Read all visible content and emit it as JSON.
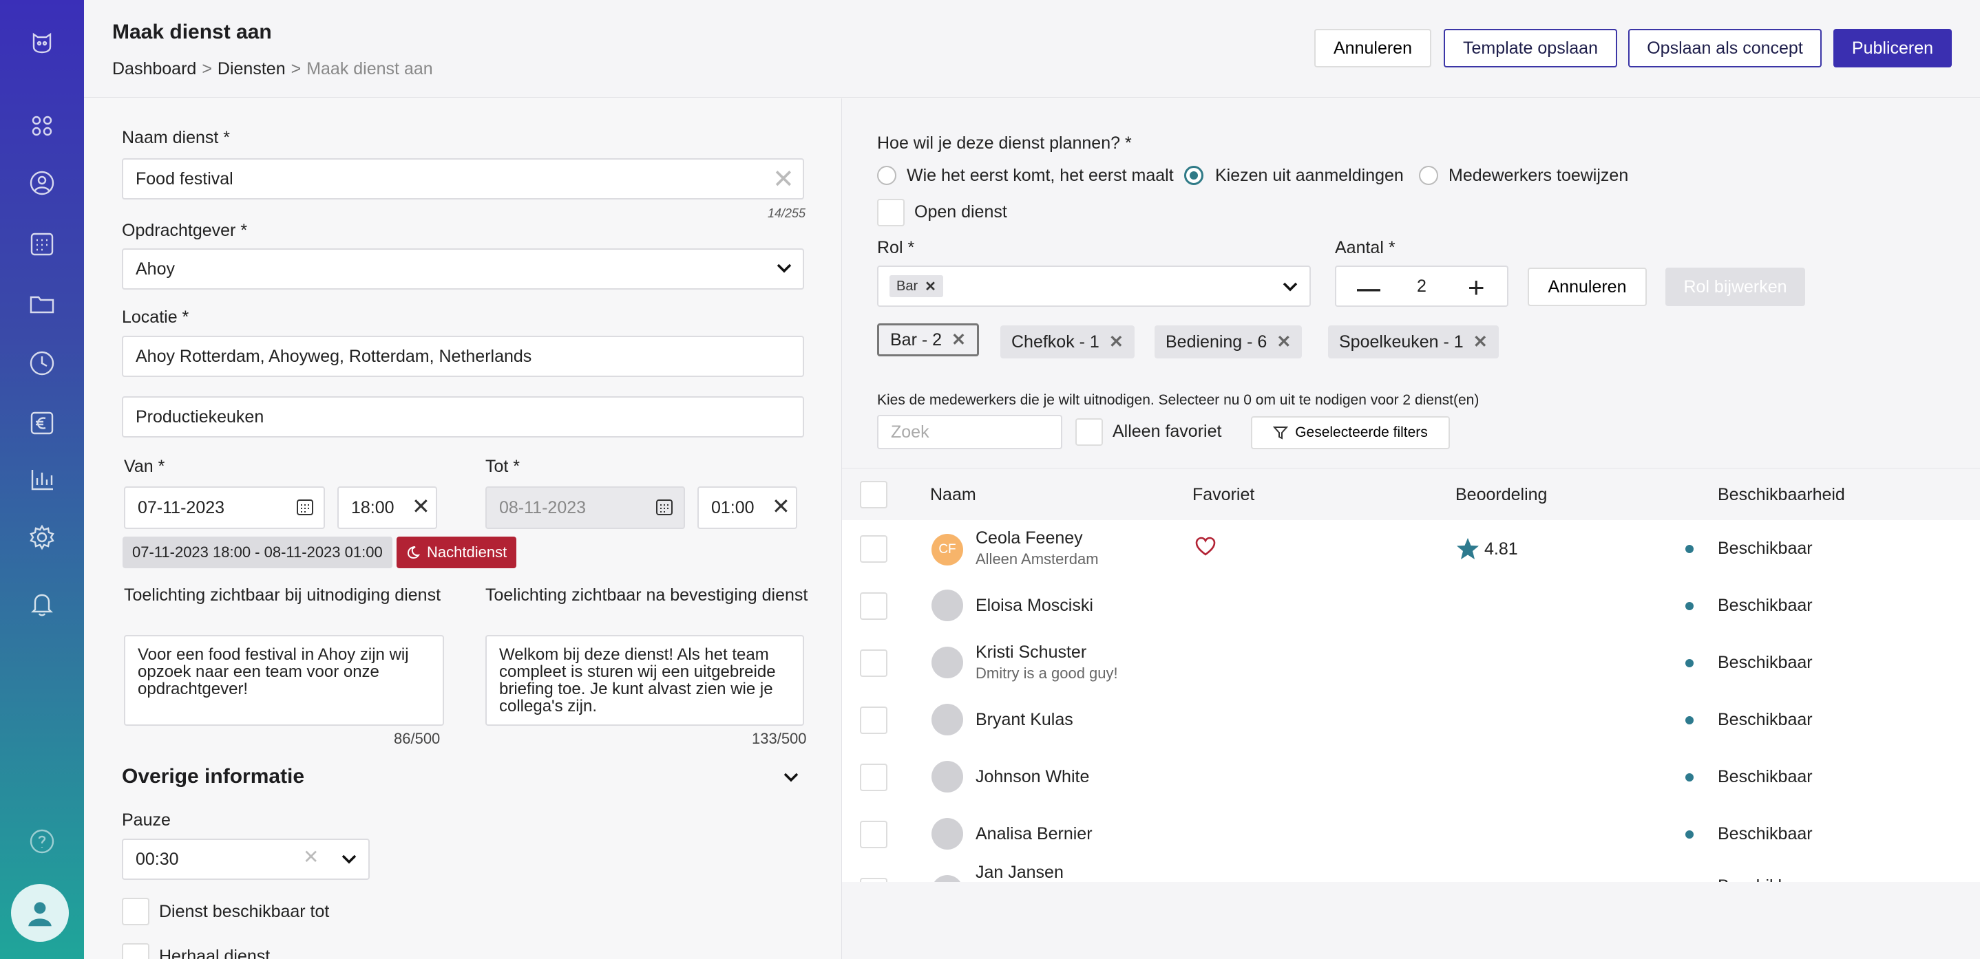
{
  "header": {
    "title": "Maak dienst aan",
    "breadcrumb": [
      "Dashboard",
      "Diensten",
      "Maak dienst aan"
    ],
    "buttons": {
      "cancel": "Annuleren",
      "save_template": "Template opslaan",
      "save_concept": "Opslaan als concept",
      "publish": "Publiceren"
    }
  },
  "sidebar": {
    "icons": [
      "logo-icon",
      "dashboard-icon",
      "user-icon",
      "calendar-icon",
      "folder-icon",
      "clock-icon",
      "euro-icon",
      "chart-icon",
      "settings-icon",
      "bell-icon",
      "help-icon",
      "profile-icon"
    ]
  },
  "form": {
    "name_label": "Naam dienst *",
    "name_value": "Food festival",
    "name_counter": "14/255",
    "client_label": "Opdrachtgever *",
    "client_value": "Ahoy",
    "location_label": "Locatie *",
    "location_value": "Ahoy Rotterdam, Ahoyweg, Rotterdam, Netherlands",
    "sublocation_value": "Productiekeuken",
    "from_label": "Van *",
    "from_date": "07-11-2023",
    "from_time": "18:00",
    "to_label": "Tot *",
    "to_date": "08-11-2023",
    "to_time": "01:00",
    "range_chip": "07-11-2023 18:00 - 08-11-2023 01:00",
    "night_chip": "Nachtdienst",
    "note_invite_label": "Toelichting zichtbaar bij uitnodiging dienst",
    "note_invite_value": "Voor een food festival in Ahoy zijn wij opzoek naar een team voor onze opdrachtgever!",
    "note_invite_counter": "86/500",
    "note_confirm_label": "Toelichting zichtbaar na bevestiging dienst",
    "note_confirm_value": "Welkom bij deze dienst! Als het team compleet is sturen wij een uitgebreide briefing toe. Je kunt alvast zien wie je collega's zijn.",
    "note_confirm_counter": "133/500",
    "other_info": "Overige informatie",
    "pause_label": "Pauze",
    "pause_value": "00:30",
    "available_until": "Dienst beschikbaar tot",
    "repeat": "Herhaal dienst"
  },
  "planning": {
    "question": "Hoe wil je deze dienst plannen? *",
    "options": [
      "Wie het eerst komt, het eerst maalt",
      "Kiezen uit aanmeldingen",
      "Medewerkers toewijzen"
    ],
    "open_shift": "Open dienst",
    "role_label": "Rol *",
    "role_chip": "Bar",
    "amount_label": "Aantal *",
    "amount_value": "2",
    "cancel": "Annuleren",
    "update_role": "Rol bijwerken",
    "role_tags": [
      "Bar - 2",
      "Chefkok - 1",
      "Bediening - 6",
      "Spoelkeuken - 1"
    ],
    "invite_text": "Kies de medewerkers die je wilt uitnodigen. Selecteer nu 0 om uit te nodigen voor 2 dienst(en)",
    "search_placeholder": "Zoek",
    "only_favorite": "Alleen favoriet",
    "filters": "Geselecteerde filters"
  },
  "table": {
    "headers": [
      "Naam",
      "Favoriet",
      "Beoordeling",
      "Beschikbaarheid"
    ],
    "rows": [
      {
        "initials": "CF",
        "name": "Ceola Feeney",
        "sub": "Alleen Amsterdam",
        "rating": "4.81",
        "status": "Beschikbaar"
      },
      {
        "name": "Eloisa Mosciski",
        "sub": "",
        "status": "Beschikbaar"
      },
      {
        "name": "Kristi Schuster",
        "sub": "Dmitry is a good guy!",
        "status": "Beschikbaar"
      },
      {
        "name": "Bryant Kulas",
        "sub": "",
        "status": "Beschikbaar"
      },
      {
        "name": "Johnson White",
        "sub": "",
        "status": "Beschikbaar"
      },
      {
        "name": "Analisa Bernier",
        "sub": "",
        "status": "Beschikbaar"
      },
      {
        "name": "Jan Jansen",
        "sub": "",
        "status": "Beschikbaar"
      }
    ]
  }
}
